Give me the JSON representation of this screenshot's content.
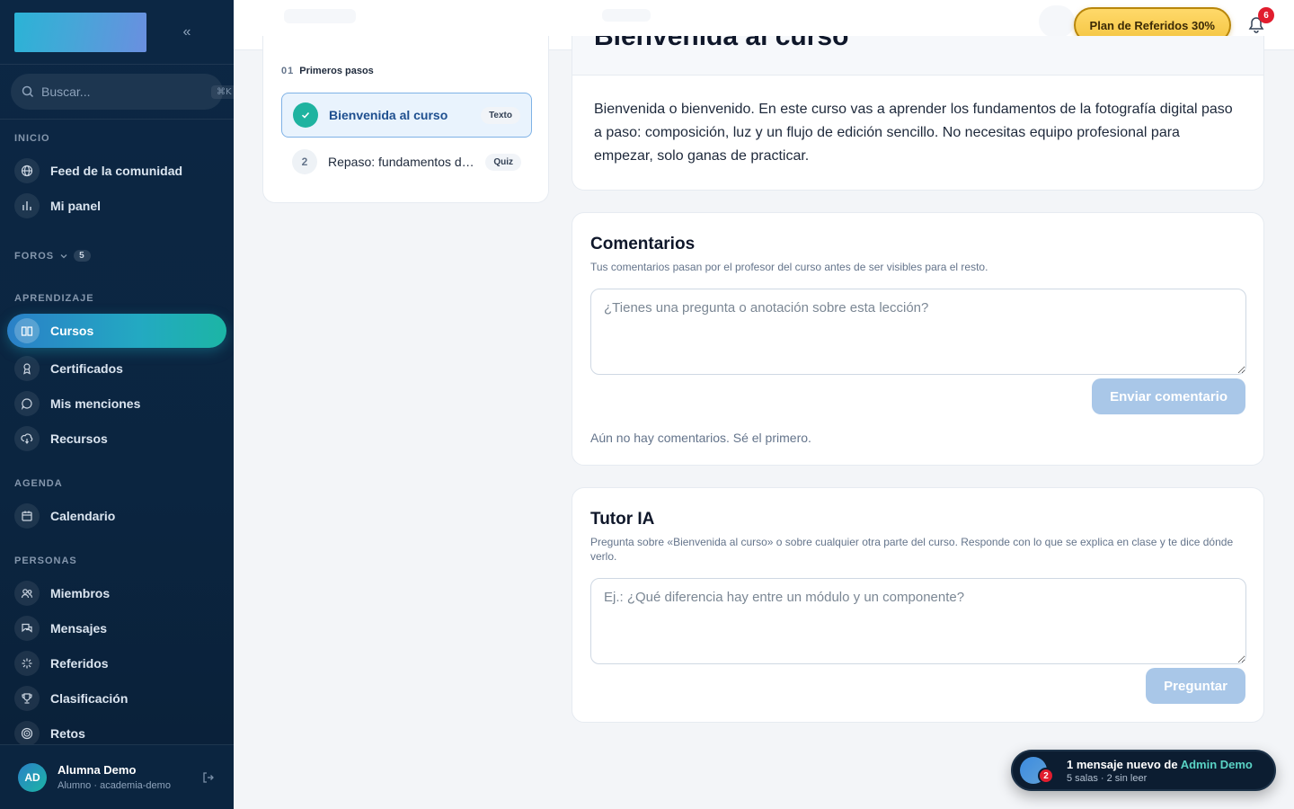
{
  "sidebar": {
    "search_placeholder": "Buscar...",
    "search_shortcut": "⌘K",
    "sections": {
      "inicio": "INICIO",
      "foros": "FOROS",
      "foros_count": "5",
      "aprendizaje": "APRENDIZAJE",
      "agenda": "AGENDA",
      "personas": "PERSONAS"
    },
    "items": {
      "feed": "Feed de la comunidad",
      "panel": "Mi panel",
      "cursos": "Cursos",
      "certificados": "Certificados",
      "menciones": "Mis menciones",
      "recursos": "Recursos",
      "calendario": "Calendario",
      "miembros": "Miembros",
      "mensajes": "Mensajes",
      "referidos": "Referidos",
      "clasificacion": "Clasificación",
      "retos": "Retos"
    },
    "user": {
      "initials": "AD",
      "name": "Alumna Demo",
      "subtitle": "Alumno · academia-demo"
    }
  },
  "topbar": {
    "referral_label": "Plan de Referidos 30%",
    "notifications_count": "6"
  },
  "lessons": {
    "module_number": "01",
    "module_title": "Primeros pasos",
    "items": [
      {
        "number": "",
        "title": "Bienvenida al curso",
        "tag": "Texto",
        "completed": true
      },
      {
        "number": "2",
        "title": "Repaso: fundamentos de composición",
        "tag": "Quiz",
        "completed": false
      }
    ]
  },
  "lesson": {
    "title": "Bienvenida al curso",
    "body": "Bienvenida o bienvenido. En este curso vas a aprender los fundamentos de la fotografía digital paso a paso: composición, luz y un flujo de edición sencillo. No necesitas equipo profesional para empezar, solo ganas de practicar."
  },
  "comments": {
    "title": "Comentarios",
    "subtitle": "Tus comentarios pasan por el profesor del curso antes de ser visibles para el resto.",
    "placeholder": "¿Tienes una pregunta o anotación sobre esta lección?",
    "submit_label": "Enviar comentario",
    "empty": "Aún no hay comentarios. Sé el primero."
  },
  "tutor": {
    "title": "Tutor IA",
    "subtitle": "Pregunta sobre «Bienvenida al curso» o sobre cualquier otra parte del curso. Responde con lo que se explica en clase y te dice dónde verlo.",
    "placeholder": "Ej.: ¿Qué diferencia hay entre un módulo y un componente?",
    "submit_label": "Preguntar"
  },
  "toast": {
    "unread_count": "2",
    "message_prefix": "1 mensaje nuevo de ",
    "sender": "Admin Demo",
    "detail": "5 salas · 2 sin leer"
  },
  "colors": {
    "sidebar_bg": "#0c2744",
    "accent_teal": "#1cb5a5",
    "accent_blue": "#2a80c7",
    "referral_gold": "#f4c542",
    "notification_red": "#e11d2e"
  }
}
